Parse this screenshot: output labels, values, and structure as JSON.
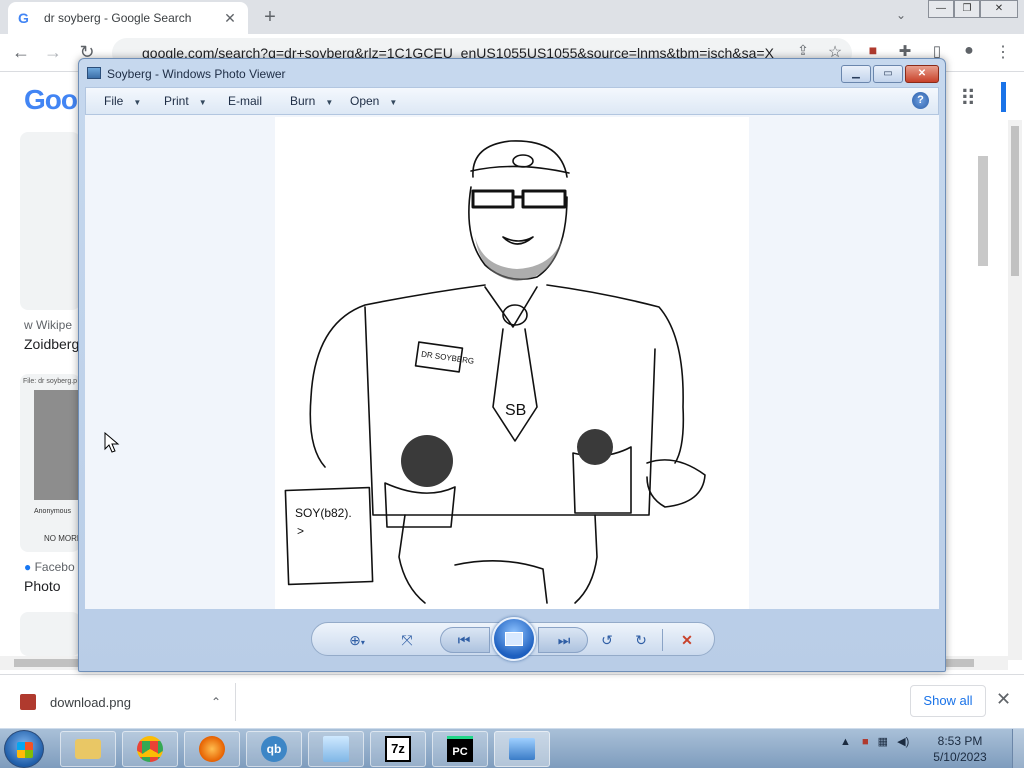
{
  "browser": {
    "tab": {
      "title": "dr soyberg - Google Search",
      "icon": "google-g-icon"
    },
    "new_tab": "+",
    "tab_dropdown": "⌄",
    "window_controls": {
      "minimize": "—",
      "restore": "❐",
      "close": "✕"
    },
    "url": "google.com/search?q=dr+soyberg&rlz=1C1GCEU_enUS1055US1055&source=lnms&tbm=isch&sa=X",
    "nav": {
      "back": "←",
      "forward": "→",
      "reload": "↻"
    }
  },
  "google": {
    "logo": "Goo",
    "results": [
      {
        "source": "w  Wikipe",
        "title": "Zoidberg"
      },
      {
        "source": "Facebo",
        "title": "Photo",
        "card_top_text": "File: dr soyberg.p",
        "card_caption": "NO MORE",
        "card_user": "Anonymous"
      }
    ]
  },
  "photo_viewer": {
    "title": "Soyberg - Windows Photo Viewer",
    "menu": {
      "file": "File",
      "print": "Print",
      "email": "E-mail",
      "burn": "Burn",
      "open": "Open"
    },
    "help": "?",
    "image": {
      "name_tag": "DR SOYBERG",
      "tie_text": "SB",
      "paper_text": "SOY(b82).",
      "paper_prompt": ">"
    },
    "controls": {
      "zoom": "zoom-icon",
      "actual_size": "actual-size-icon",
      "previous": "previous-icon",
      "slideshow": "slideshow-icon",
      "next": "next-icon",
      "rotate_ccw": "rotate-ccw-icon",
      "rotate_cw": "rotate-cw-icon",
      "delete": "delete-icon"
    }
  },
  "download_bar": {
    "file_name": "download.png",
    "chevron": "⌃",
    "show_all": "Show all",
    "close": "✕"
  },
  "taskbar": {
    "apps": [
      "explorer",
      "chrome",
      "firefox",
      "qbittorrent",
      "notepad",
      "7zip",
      "pycharm",
      "photo-viewer"
    ],
    "labels": {
      "qb": "qb",
      "sevenzip": "7z",
      "pycharm": "PC"
    },
    "time": "8:53 PM",
    "date": "5/10/2023"
  },
  "colors": {
    "accent": "#1a73e8",
    "viewer_frame": "#c6d8ee",
    "close_red": "#c8412a"
  }
}
